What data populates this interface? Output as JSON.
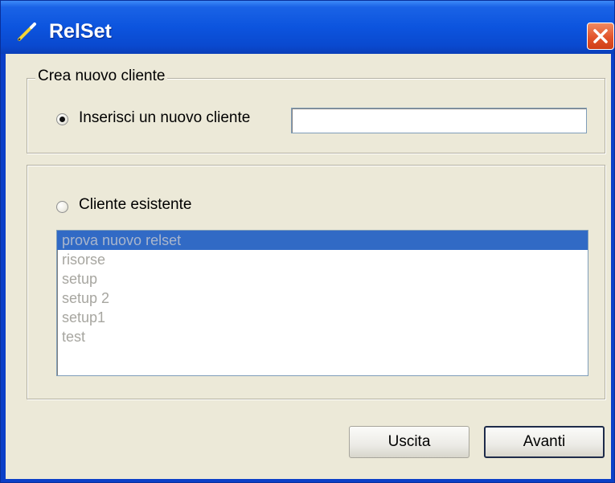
{
  "window": {
    "title": "RelSet",
    "colors": {
      "titlebar": "#0c54de",
      "client": "#ece9d8",
      "selection": "#316ac5",
      "close": "#e2532a"
    }
  },
  "new_client_group": {
    "legend": "Crea nuovo cliente",
    "radio_label": "Inserisci un nuovo cliente",
    "radio_checked": true,
    "input_value": ""
  },
  "existing_client_group": {
    "radio_label": "Cliente esistente",
    "radio_checked": false,
    "list_items": [
      "prova nuovo relset",
      "risorse",
      "setup",
      "setup 2",
      "setup1",
      "test"
    ],
    "selected_index": 0
  },
  "buttons": {
    "exit": "Uscita",
    "next": "Avanti"
  },
  "icons": {
    "app": "pencil-icon",
    "close": "close-icon"
  }
}
